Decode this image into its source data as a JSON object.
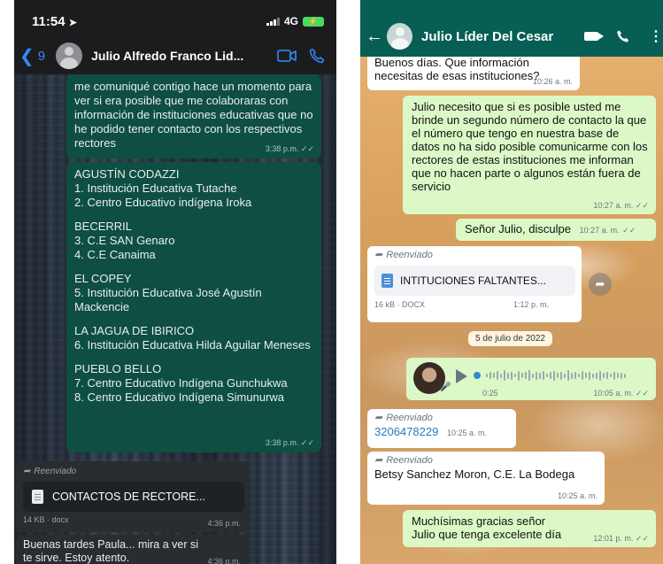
{
  "left": {
    "status_time": "11:54",
    "status_network": "4G",
    "back_count": "9",
    "contact_name": "Julio Alfredo Franco Lid...",
    "messages": {
      "m1_text": "me comuniqué contigo hace un momento para ver si era posible que me colaboraras con información de instituciones educativas que no he podido tener contacto con los respectivos rectores",
      "m1_time": "3:38 p.m.",
      "m2": {
        "g1_title": "AGUSTÍN CODAZZI",
        "g1_l1": "1. Institución Educativa Tutache",
        "g1_l2": "2. Centro Educativo indígena Iroka",
        "g2_title": "BECERRIL",
        "g2_l1": "3. C.E SAN Genaro",
        "g2_l2": "4. C.E Canaima",
        "g3_title": "EL COPEY",
        "g3_l1": "5. Institución Educativa José Agustín Mackencie",
        "g4_title": "LA JAGUA DE IBIRICO",
        "g4_l1": "6. Institución Educativa Hilda Aguilar Meneses",
        "g5_title": "PUEBLO BELLO",
        "g5_l1": "7. Centro Educativo Indígena Gunchukwa",
        "g5_l2": "8. Centro Educativo Indígena Simunurwa",
        "time": "3:38 p.m."
      },
      "m3_forward": "Reenviado",
      "m3_doc_name": "CONTACTOS DE RECTORE...",
      "m3_doc_meta": "14 KB · docx",
      "m3_time": "4:36 p.m.",
      "m4_text": "Buenas tardes Paula... mira a ver si te sirve. Estoy atento.",
      "m4_time": "4:36 p.m."
    }
  },
  "right": {
    "contact_name": "Julio Líder Del Cesar",
    "messages": {
      "r1_text": "Buenos días. Que información necesitas de esas instituciones?",
      "r1_time": "10:26 a. m.",
      "r2_text": "Julio necesito que si es posible usted me brinde un segundo número de contacto la que el número que tengo en nuestra base de datos no ha sido posible comunicarme con los rectores de estas instituciones me informan que no hacen parte o algunos están fuera de servicio",
      "r2_time": "10:27 a. m.",
      "r3_text": "Señor Julio, disculpe",
      "r3_time": "10:27 a. m.",
      "r4_forward": "Reenviado",
      "r4_doc_name": "INTITUCIONES FALTANTES...",
      "r4_doc_meta": "16 kB · DOCX",
      "r4_time": "1:12 p. m.",
      "date_divider": "5 de julio de 2022",
      "r5_duration": "0:25",
      "r5_time": "10:05 a. m.",
      "r6_forward": "Reenviado",
      "r6_number": "3206478229",
      "r6_time": "10:25 a. m.",
      "r7_forward": "Reenviado",
      "r7_text": "Betsy Sanchez Moron, C.E. La Bodega",
      "r7_time": "10:25 a. m.",
      "r8_text": "Muchísimas gracias señor Julio que tenga excelente día",
      "r8_time": "12:01 p. m."
    }
  },
  "icons": [
    "location-arrow-icon",
    "signal-icon",
    "battery-icon",
    "back-chevron-icon",
    "video-icon",
    "phone-icon",
    "forward-icon",
    "document-icon",
    "share-icon",
    "play-icon",
    "mic-icon",
    "menu-dots-icon",
    "double-check-icon"
  ],
  "colors": {
    "left_outgoing": "#0e4f42",
    "left_incoming": "#2a2d30",
    "ios_blue": "#2f8cff",
    "wa_header": "#075e54",
    "wa_outgoing": "#dcf8c6",
    "wa_incoming": "#ffffff"
  }
}
